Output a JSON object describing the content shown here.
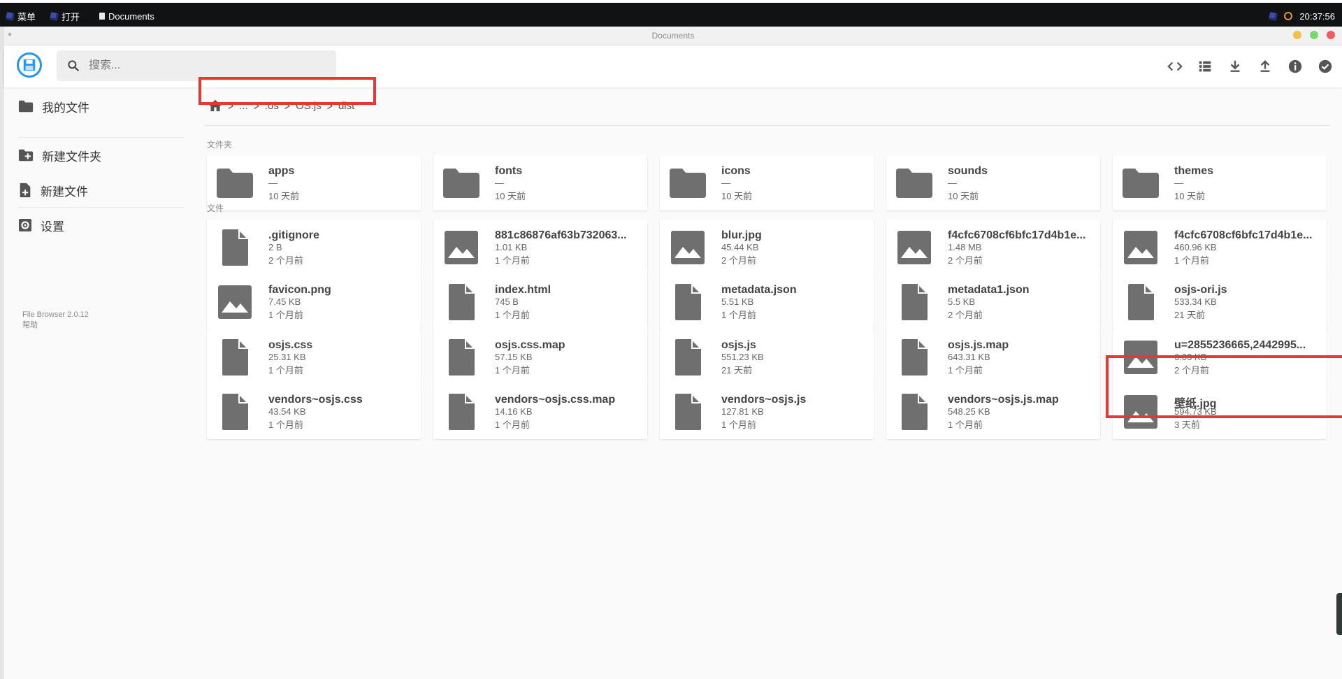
{
  "taskbar": {
    "menu": "菜单",
    "open": "打开",
    "app": "Documents",
    "clock": "20:37:56"
  },
  "window": {
    "title": "Documents"
  },
  "colors": {
    "accent": "#2196f3",
    "close": "#f05b5b",
    "minimize": "#f5c04a",
    "maximize": "#7ad66d",
    "highlight": "#e53935",
    "icon_gray": "#6f6f6f"
  },
  "header": {
    "search_placeholder": "搜索...",
    "actions": [
      "code-icon",
      "list-view-icon",
      "download-icon",
      "upload-icon",
      "info-icon",
      "check-circle-icon"
    ]
  },
  "sidebar": {
    "items": [
      {
        "label": "我的文件",
        "icon": "folder-icon"
      },
      {
        "label": "新建文件夹",
        "icon": "create-folder-icon"
      },
      {
        "label": "新建文件",
        "icon": "create-file-icon"
      },
      {
        "label": "设置",
        "icon": "settings-icon"
      }
    ],
    "version": "File Browser 2.0.12",
    "help": "帮助"
  },
  "breadcrumbs": [
    "...",
    ".os",
    "OS.js",
    "dist"
  ],
  "sections": {
    "folders": "文件夹",
    "files": "文件"
  },
  "folders": [
    {
      "name": "apps",
      "size": "—",
      "date": "10 天前"
    },
    {
      "name": "fonts",
      "size": "—",
      "date": "10 天前"
    },
    {
      "name": "icons",
      "size": "—",
      "date": "10 天前"
    },
    {
      "name": "sounds",
      "size": "—",
      "date": "10 天前"
    },
    {
      "name": "themes",
      "size": "—",
      "date": "10 天前"
    }
  ],
  "files": [
    {
      "name": ".gitignore",
      "size": "2 B",
      "date": "2 个月前",
      "icon": "file"
    },
    {
      "name": "881c86876af63b732063...",
      "size": "1.01 KB",
      "date": "1 个月前",
      "icon": "image"
    },
    {
      "name": "blur.jpg",
      "size": "45.44 KB",
      "date": "2 个月前",
      "icon": "image"
    },
    {
      "name": "f4cfc6708cf6bfc17d4b1e...",
      "size": "1.48 MB",
      "date": "2 个月前",
      "icon": "image"
    },
    {
      "name": "f4cfc6708cf6bfc17d4b1e...",
      "size": "460.96 KB",
      "date": "1 个月前",
      "icon": "image"
    },
    {
      "name": "favicon.png",
      "size": "7.45 KB",
      "date": "1 个月前",
      "icon": "image"
    },
    {
      "name": "index.html",
      "size": "745 B",
      "date": "1 个月前",
      "icon": "file"
    },
    {
      "name": "metadata.json",
      "size": "5.51 KB",
      "date": "1 个月前",
      "icon": "file"
    },
    {
      "name": "metadata1.json",
      "size": "5.5 KB",
      "date": "2 个月前",
      "icon": "file"
    },
    {
      "name": "osjs-ori.js",
      "size": "533.34 KB",
      "date": "21 天前",
      "icon": "file"
    },
    {
      "name": "osjs.css",
      "size": "25.31 KB",
      "date": "1 个月前",
      "icon": "file"
    },
    {
      "name": "osjs.css.map",
      "size": "57.15 KB",
      "date": "1 个月前",
      "icon": "file"
    },
    {
      "name": "osjs.js",
      "size": "551.23 KB",
      "date": "21 天前",
      "icon": "file"
    },
    {
      "name": "osjs.js.map",
      "size": "643.31 KB",
      "date": "1 个月前",
      "icon": "file"
    },
    {
      "name": "u=2855236665,2442995...",
      "size": "6.03 KB",
      "date": "2 个月前",
      "icon": "image"
    },
    {
      "name": "vendors~osjs.css",
      "size": "43.54 KB",
      "date": "1 个月前",
      "icon": "file"
    },
    {
      "name": "vendors~osjs.css.map",
      "size": "14.16 KB",
      "date": "1 个月前",
      "icon": "file"
    },
    {
      "name": "vendors~osjs.js",
      "size": "127.81 KB",
      "date": "1 个月前",
      "icon": "file"
    },
    {
      "name": "vendors~osjs.js.map",
      "size": "548.25 KB",
      "date": "1 个月前",
      "icon": "file"
    },
    {
      "name": "壁纸.jpg",
      "size": "594.73 KB",
      "date": "3 天前",
      "icon": "image"
    }
  ]
}
